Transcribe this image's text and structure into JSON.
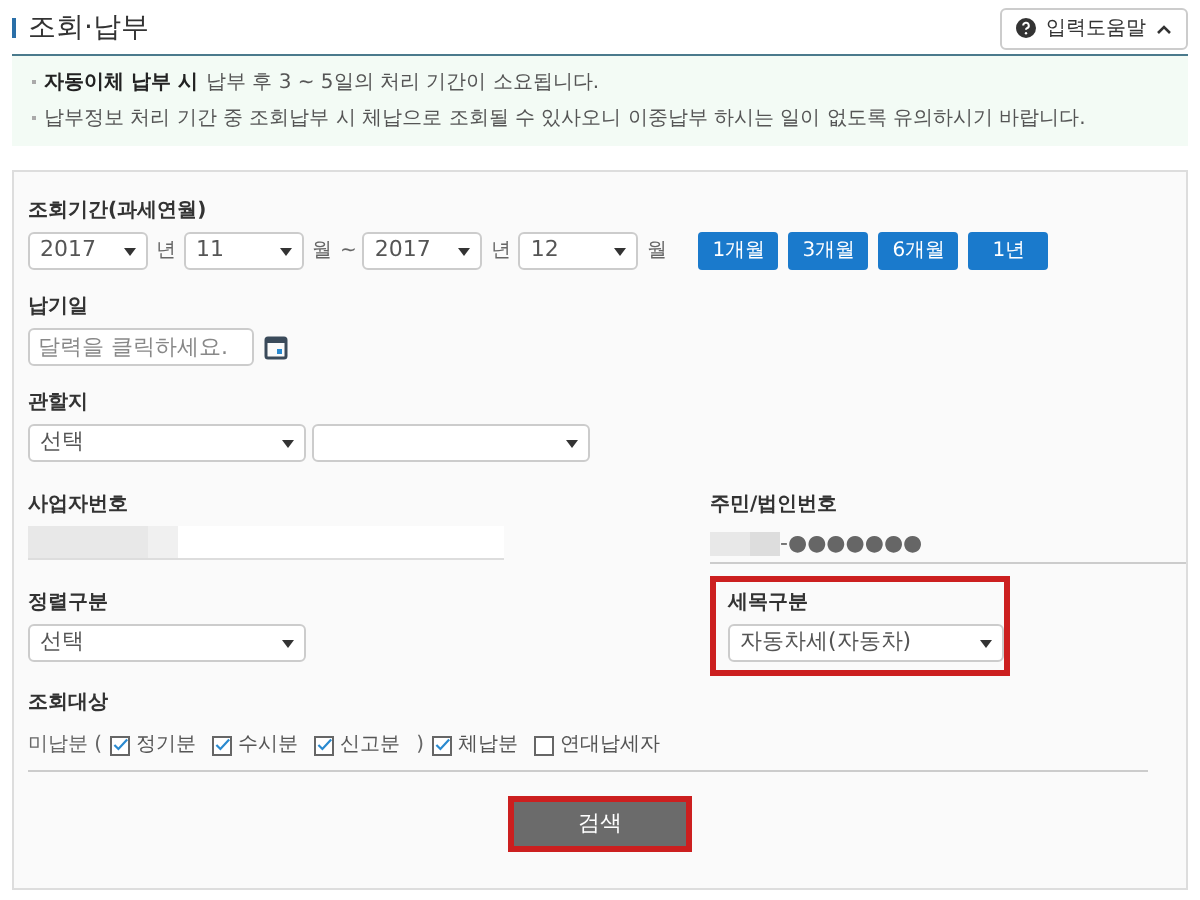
{
  "title": "조회·납부",
  "help_button": {
    "label": "입력도움말",
    "expanded": true
  },
  "notices": [
    {
      "bold": "자동이체 납부 시",
      "text": "납부 후 3 ~ 5일의 처리 기간이 소요됩니다."
    },
    {
      "text": "납부정보 처리 기간 중 조회납부 시 체납으로 조회될 수 있사오니 이중납부 하시는 일이 없도록 유의하시기 바랍니다."
    }
  ],
  "period": {
    "label": "조회기간(과세연월)",
    "from_year": "2017",
    "from_year_unit": "년",
    "from_month": "11",
    "from_month_unit": "월",
    "separator": "~",
    "to_year": "2017",
    "to_year_unit": "년",
    "to_month": "12",
    "to_month_unit": "월",
    "buttons": [
      "1개월",
      "3개월",
      "6개월",
      "1년"
    ]
  },
  "due_date": {
    "label": "납기일",
    "placeholder": "달력을 클릭하세요."
  },
  "jurisdiction": {
    "label": "관할지",
    "first": "선택"
  },
  "business_number": {
    "label": "사업자번호"
  },
  "resident_number": {
    "label": "주민/법인번호",
    "masked": "-●●●●●●●"
  },
  "sort": {
    "label": "정렬구분",
    "value": "선택"
  },
  "tax_item": {
    "label": "세목구분",
    "value": "자동차세(자동차)",
    "highlighted": true
  },
  "target": {
    "label": "조회대상",
    "items": [
      {
        "kind": "text",
        "text": "미납분 ("
      },
      {
        "kind": "checkbox",
        "text": "정기분",
        "checked": true
      },
      {
        "kind": "checkbox",
        "text": "수시분",
        "checked": true
      },
      {
        "kind": "checkbox",
        "text": "신고분",
        "checked": true
      },
      {
        "kind": "text",
        "text": ")"
      },
      {
        "kind": "checkbox",
        "text": "체납분",
        "checked": true
      },
      {
        "kind": "checkbox",
        "text": "연대납세자",
        "checked": false
      }
    ]
  },
  "search_button": {
    "label": "검색",
    "highlighted": true
  }
}
